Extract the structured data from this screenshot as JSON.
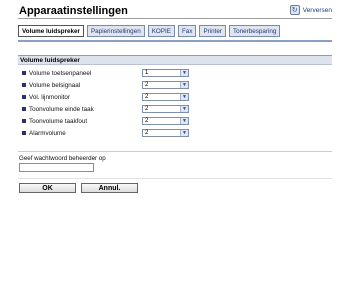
{
  "header": {
    "title": "Apparaatinstellingen",
    "refresh_label": "Verversen",
    "refresh_icon": "refresh-icon"
  },
  "tabs": [
    {
      "label": "Volume luidspreker",
      "active": true
    },
    {
      "label": "Papierinstellingen",
      "active": false
    },
    {
      "label": "KOPIE",
      "active": false
    },
    {
      "label": "Fax",
      "active": false
    },
    {
      "label": "Printer",
      "active": false
    },
    {
      "label": "Tonerbesparing",
      "active": false
    }
  ],
  "section": {
    "title": "Volume luidspreker",
    "rows": [
      {
        "label": "Volume toetsenpaneel",
        "value": "1"
      },
      {
        "label": "Volume belsignaal",
        "value": "2"
      },
      {
        "label": "Vol. lijnmonitor",
        "value": "2"
      },
      {
        "label": "Toonvolume einde taak",
        "value": "2"
      },
      {
        "label": "Toonvolume taakfout",
        "value": "2"
      },
      {
        "label": "Alarmvolume",
        "value": "2"
      }
    ]
  },
  "admin": {
    "label": "Geef wachtwoord beheerder op",
    "value": ""
  },
  "buttons": {
    "ok": "OK",
    "cancel": "Annul."
  }
}
